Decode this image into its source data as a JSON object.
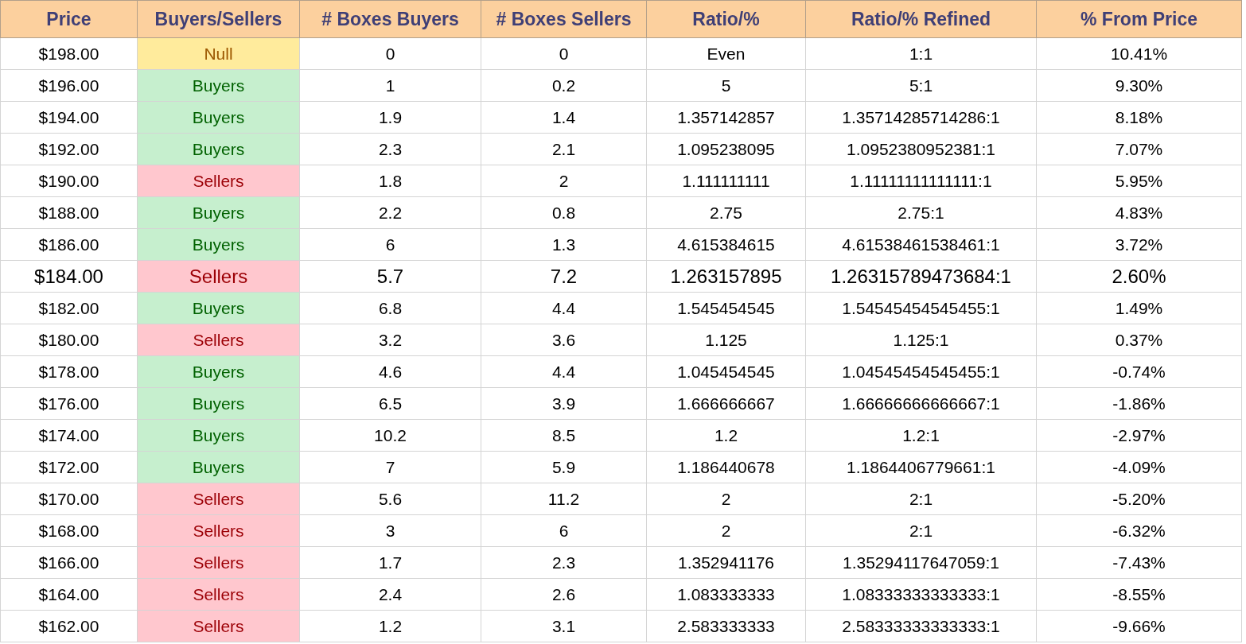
{
  "table": {
    "columns": [
      "Price",
      "Buyers/Sellers",
      "# Boxes Buyers",
      "# Boxes Sellers",
      "Ratio/%",
      "Ratio/% Refined",
      "% From Price"
    ],
    "rows": [
      {
        "price": "$198.00",
        "side": {
          "label": "Null",
          "kind": "null"
        },
        "boxes_buyers": "0",
        "boxes_sellers": "0",
        "ratio": "Even",
        "ratio_refined": "1:1",
        "from_price": "10.41%",
        "emphasis": false
      },
      {
        "price": "$196.00",
        "side": {
          "label": "Buyers",
          "kind": "buyers"
        },
        "boxes_buyers": "1",
        "boxes_sellers": "0.2",
        "ratio": "5",
        "ratio_refined": "5:1",
        "from_price": "9.30%",
        "emphasis": false
      },
      {
        "price": "$194.00",
        "side": {
          "label": "Buyers",
          "kind": "buyers"
        },
        "boxes_buyers": "1.9",
        "boxes_sellers": "1.4",
        "ratio": "1.357142857",
        "ratio_refined": "1.35714285714286:1",
        "from_price": "8.18%",
        "emphasis": false
      },
      {
        "price": "$192.00",
        "side": {
          "label": "Buyers",
          "kind": "buyers"
        },
        "boxes_buyers": "2.3",
        "boxes_sellers": "2.1",
        "ratio": "1.095238095",
        "ratio_refined": "1.0952380952381:1",
        "from_price": "7.07%",
        "emphasis": false
      },
      {
        "price": "$190.00",
        "side": {
          "label": "Sellers",
          "kind": "sellers"
        },
        "boxes_buyers": "1.8",
        "boxes_sellers": "2",
        "ratio": "1.111111111",
        "ratio_refined": "1.11111111111111:1",
        "from_price": "5.95%",
        "emphasis": false
      },
      {
        "price": "$188.00",
        "side": {
          "label": "Buyers",
          "kind": "buyers"
        },
        "boxes_buyers": "2.2",
        "boxes_sellers": "0.8",
        "ratio": "2.75",
        "ratio_refined": "2.75:1",
        "from_price": "4.83%",
        "emphasis": false
      },
      {
        "price": "$186.00",
        "side": {
          "label": "Buyers",
          "kind": "buyers"
        },
        "boxes_buyers": "6",
        "boxes_sellers": "1.3",
        "ratio": "4.615384615",
        "ratio_refined": "4.61538461538461:1",
        "from_price": "3.72%",
        "emphasis": false
      },
      {
        "price": "$184.00",
        "side": {
          "label": "Sellers",
          "kind": "sellers"
        },
        "boxes_buyers": "5.7",
        "boxes_sellers": "7.2",
        "ratio": "1.263157895",
        "ratio_refined": "1.26315789473684:1",
        "from_price": "2.60%",
        "emphasis": true
      },
      {
        "price": "$182.00",
        "side": {
          "label": "Buyers",
          "kind": "buyers"
        },
        "boxes_buyers": "6.8",
        "boxes_sellers": "4.4",
        "ratio": "1.545454545",
        "ratio_refined": "1.54545454545455:1",
        "from_price": "1.49%",
        "emphasis": false
      },
      {
        "price": "$180.00",
        "side": {
          "label": "Sellers",
          "kind": "sellers"
        },
        "boxes_buyers": "3.2",
        "boxes_sellers": "3.6",
        "ratio": "1.125",
        "ratio_refined": "1.125:1",
        "from_price": "0.37%",
        "emphasis": false
      },
      {
        "price": "$178.00",
        "side": {
          "label": "Buyers",
          "kind": "buyers"
        },
        "boxes_buyers": "4.6",
        "boxes_sellers": "4.4",
        "ratio": "1.045454545",
        "ratio_refined": "1.04545454545455:1",
        "from_price": "-0.74%",
        "emphasis": false
      },
      {
        "price": "$176.00",
        "side": {
          "label": "Buyers",
          "kind": "buyers"
        },
        "boxes_buyers": "6.5",
        "boxes_sellers": "3.9",
        "ratio": "1.666666667",
        "ratio_refined": "1.66666666666667:1",
        "from_price": "-1.86%",
        "emphasis": false
      },
      {
        "price": "$174.00",
        "side": {
          "label": "Buyers",
          "kind": "buyers"
        },
        "boxes_buyers": "10.2",
        "boxes_sellers": "8.5",
        "ratio": "1.2",
        "ratio_refined": "1.2:1",
        "from_price": "-2.97%",
        "emphasis": false
      },
      {
        "price": "$172.00",
        "side": {
          "label": "Buyers",
          "kind": "buyers"
        },
        "boxes_buyers": "7",
        "boxes_sellers": "5.9",
        "ratio": "1.186440678",
        "ratio_refined": "1.1864406779661:1",
        "from_price": "-4.09%",
        "emphasis": false
      },
      {
        "price": "$170.00",
        "side": {
          "label": "Sellers",
          "kind": "sellers"
        },
        "boxes_buyers": "5.6",
        "boxes_sellers": "11.2",
        "ratio": "2",
        "ratio_refined": "2:1",
        "from_price": "-5.20%",
        "emphasis": false
      },
      {
        "price": "$168.00",
        "side": {
          "label": "Sellers",
          "kind": "sellers"
        },
        "boxes_buyers": "3",
        "boxes_sellers": "6",
        "ratio": "2",
        "ratio_refined": "2:1",
        "from_price": "-6.32%",
        "emphasis": false
      },
      {
        "price": "$166.00",
        "side": {
          "label": "Sellers",
          "kind": "sellers"
        },
        "boxes_buyers": "1.7",
        "boxes_sellers": "2.3",
        "ratio": "1.352941176",
        "ratio_refined": "1.35294117647059:1",
        "from_price": "-7.43%",
        "emphasis": false
      },
      {
        "price": "$164.00",
        "side": {
          "label": "Sellers",
          "kind": "sellers"
        },
        "boxes_buyers": "2.4",
        "boxes_sellers": "2.6",
        "ratio": "1.083333333",
        "ratio_refined": "1.08333333333333:1",
        "from_price": "-8.55%",
        "emphasis": false
      },
      {
        "price": "$162.00",
        "side": {
          "label": "Sellers",
          "kind": "sellers"
        },
        "boxes_buyers": "1.2",
        "boxes_sellers": "3.1",
        "ratio": "2.583333333",
        "ratio_refined": "2.58333333333333:1",
        "from_price": "-9.66%",
        "emphasis": false
      }
    ]
  }
}
